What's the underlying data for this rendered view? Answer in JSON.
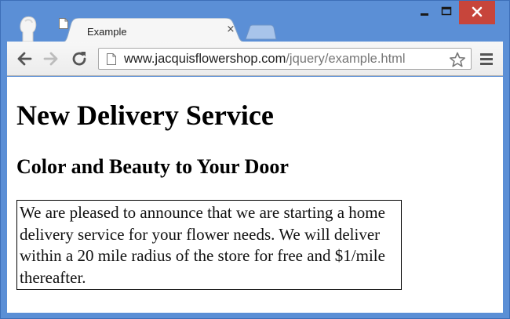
{
  "browser": {
    "tab": {
      "title": "Example",
      "close_glyph": "×"
    },
    "address": {
      "host": "www.jacquisflowershop.com",
      "path": "/jquery/example.html"
    },
    "icons": [
      "profile-icon",
      "page-icon",
      "close-icon",
      "new-tab-icon",
      "minimize-icon",
      "maximize-icon",
      "window-close-icon",
      "back-icon",
      "forward-icon",
      "reload-icon",
      "star-icon",
      "menu-icon"
    ],
    "colors": {
      "frame": "#5b8fd6",
      "close_button": "#c7453b"
    }
  },
  "page": {
    "heading": "New Delivery Service",
    "subheading": "Color and Beauty to Your Door",
    "paragraph": "We are pleased to announce that we are starting a home delivery service for your flower needs. We will deliver within a 20 mile radius of the store for free and $1/mile thereafter."
  }
}
